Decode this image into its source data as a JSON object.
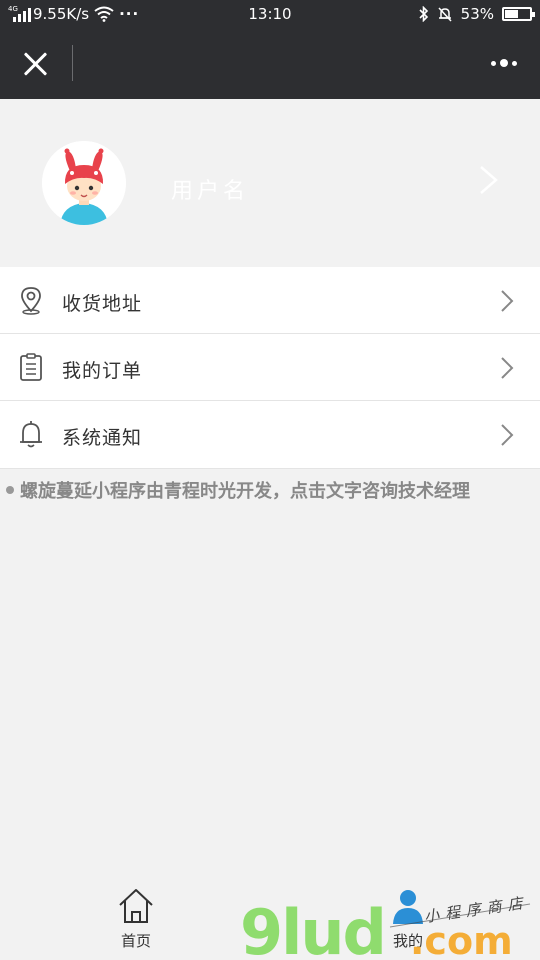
{
  "status_bar": {
    "network": "4G",
    "speed": "9.55K/s",
    "more": "···",
    "time": "13:10",
    "battery_percent": "53%",
    "battery_level": 0.53
  },
  "nav": {
    "close_icon": "close-icon",
    "more_icon": "more-dots-icon"
  },
  "profile": {
    "username": "用户名"
  },
  "menu": {
    "items": [
      {
        "label": "收货地址",
        "icon": "location-pin-icon"
      },
      {
        "label": "我的订单",
        "icon": "order-list-icon"
      },
      {
        "label": "系统通知",
        "icon": "bell-icon"
      }
    ]
  },
  "credit": {
    "text": "螺旋蔓延小程序由青程时光开发，点击文字咨询技术经理"
  },
  "tab_bar": {
    "home": "首页",
    "mine": "我的"
  },
  "watermark": {
    "logo": "9lud.com",
    "slogan": "小程序商店"
  }
}
